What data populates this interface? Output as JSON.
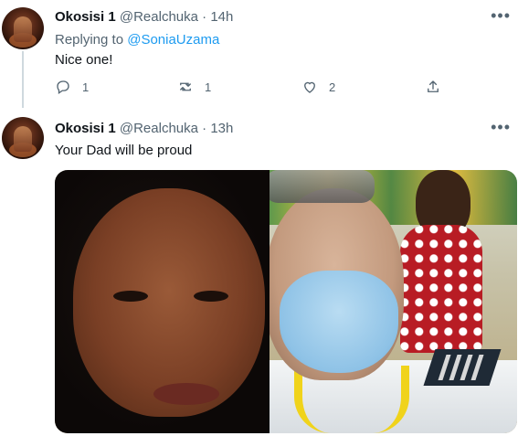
{
  "tweets": [
    {
      "name": "Okosisi 1",
      "handle": "@Realchuka",
      "sep": "·",
      "time": "14h",
      "replying_prefix": "Replying to",
      "replying_to": "@SoniaUzama",
      "text": "Nice one!",
      "actions": {
        "reply": "1",
        "retweet": "1",
        "like": "2"
      }
    },
    {
      "name": "Okosisi 1",
      "handle": "@Realchuka",
      "sep": "·",
      "time": "13h",
      "text": "Your Dad will be proud"
    }
  ],
  "icons": {
    "more": "more-icon",
    "reply": "reply-icon",
    "retweet": "retweet-icon",
    "like": "heart-icon",
    "share": "share-icon"
  },
  "colors": {
    "link": "#1d9bf0",
    "secondary": "#536471",
    "thread": "#cfd9de"
  }
}
